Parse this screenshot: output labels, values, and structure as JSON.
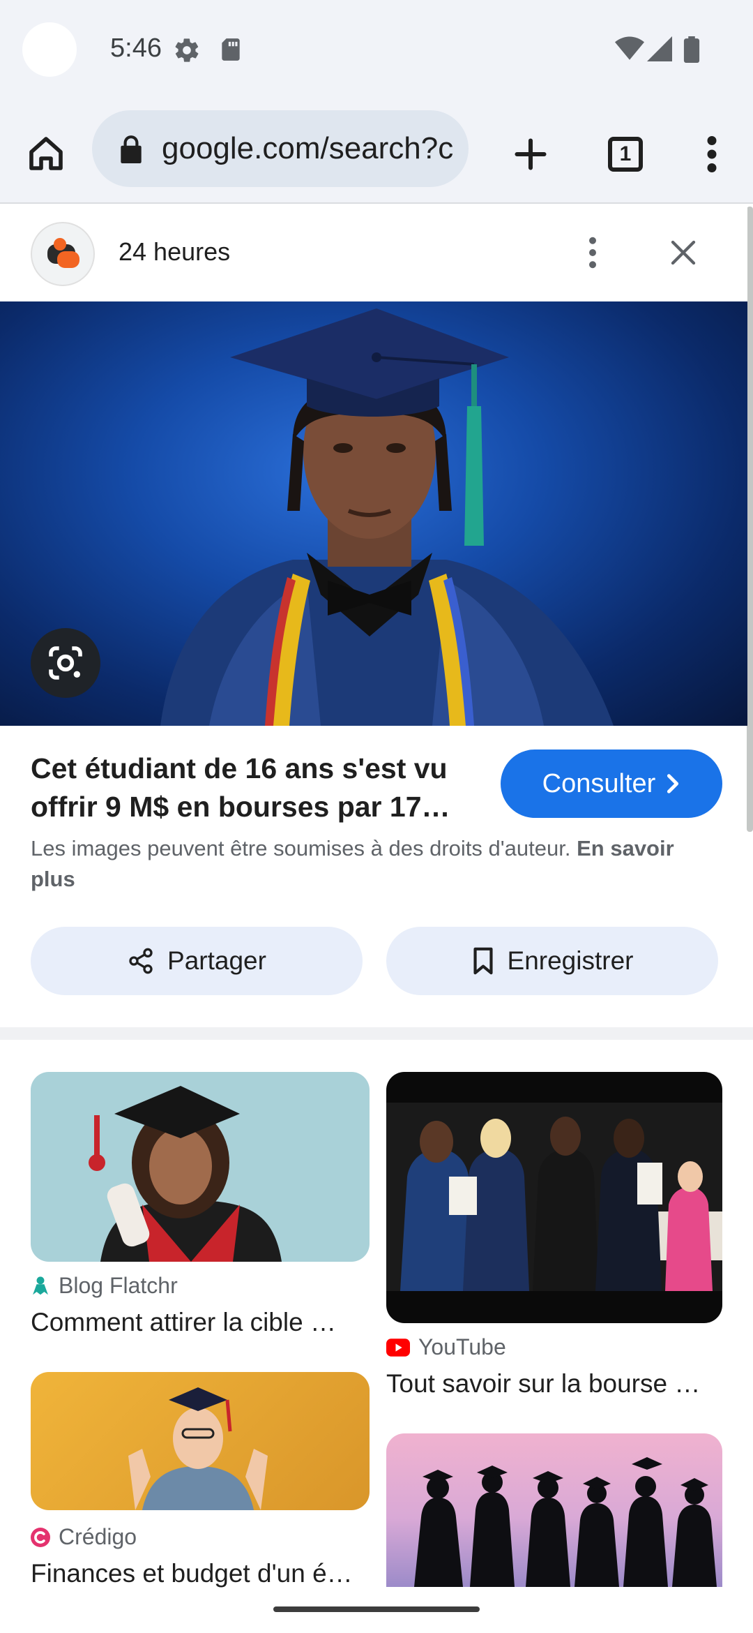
{
  "status_bar": {
    "time": "5:46"
  },
  "toolbar": {
    "url": "google.com/search?c",
    "tab_count": "1"
  },
  "source": {
    "name": "24 heures"
  },
  "result": {
    "title": "Cet étudiant de 16 ans s'est vu offrir 9 M$ en bourses par 17…",
    "visit_label": "Consulter",
    "copyright_text": "Les images peuvent être soumises à des droits d'auteur.",
    "learn_more": "En savoir plus",
    "share_label": "Partager",
    "save_label": "Enregistrer"
  },
  "related": [
    {
      "source": "Blog Flatchr",
      "title": "Comment attirer la cible …"
    },
    {
      "source": "YouTube",
      "title": "Tout savoir sur la bourse …"
    },
    {
      "source": "Crédigo",
      "title": "Finances et budget d'un é…"
    }
  ],
  "colors": {
    "accent": "#1a73e8",
    "chip": "#e8eefa",
    "chrome": "#f1f3f8"
  }
}
